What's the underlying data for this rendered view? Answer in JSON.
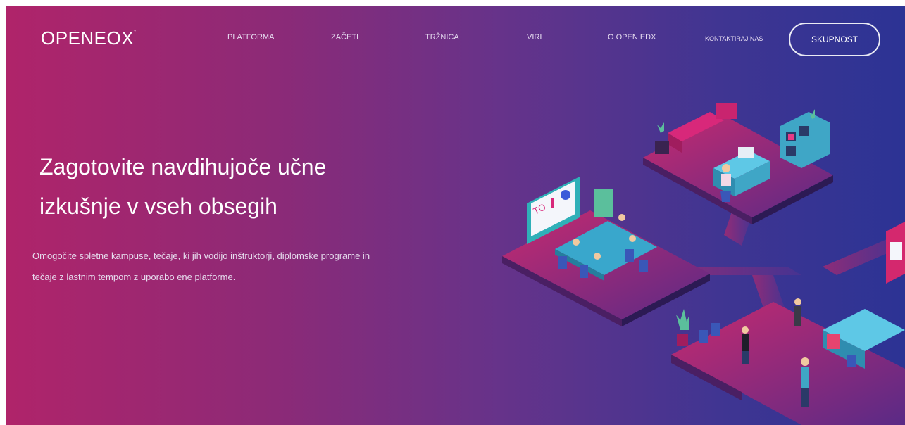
{
  "header": {
    "logo": "OPENEOX",
    "nav": [
      "PLATFORMA",
      "ZAČETI",
      "TRŽNICA",
      "VIRI",
      "O OPEN EDX",
      "KONTAKTIRAJ NAS"
    ],
    "cta": "SKUPNOST"
  },
  "hero": {
    "headline_line1": "Zagotovite navdihujoče učne",
    "headline_line2": "izkušnje v vseh obsegih",
    "sub_line1": "Omogočite spletne kampuse, tečaje, ki jih vodijo inštruktorji, diplomske programe in",
    "sub_line2": "tečaje z lastnim tempom z uporabo ene platforme.",
    "whiteboard_text": "TO"
  },
  "colors": {
    "gradient_start": "#b0246a",
    "gradient_end": "#2c3394",
    "accent_pink": "#d4286e",
    "furniture_teal": "#3fa6c6"
  }
}
